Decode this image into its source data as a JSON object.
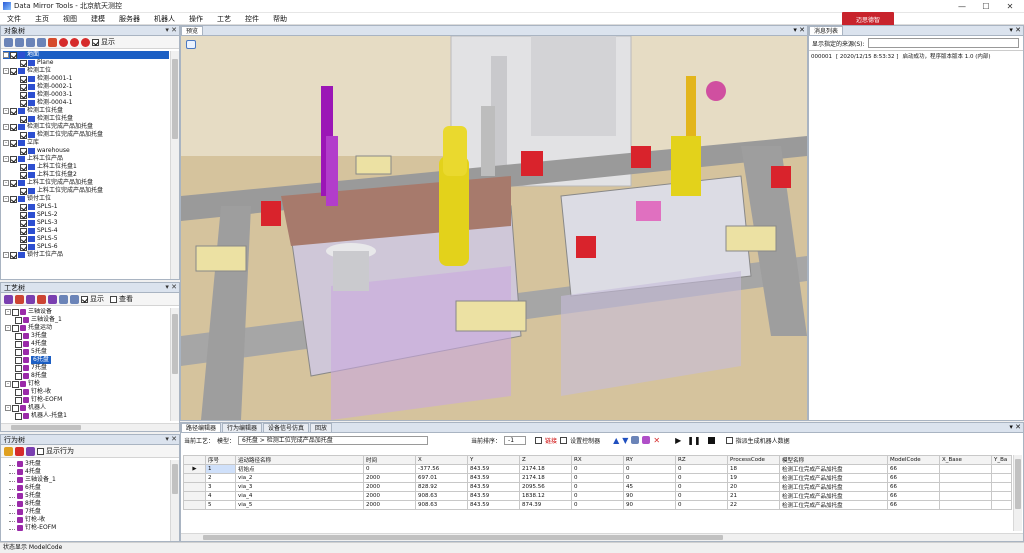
{
  "window": {
    "title": "Data Mirror Tools - 北京航天测控",
    "minimize": "—",
    "maximize": "☐",
    "close": "✕"
  },
  "menu": [
    "文件",
    "主页",
    "视图",
    "建模",
    "服务器",
    "机器人",
    "操作",
    "工艺",
    "控件",
    "帮助"
  ],
  "brand": {
    "logo_text": "迈思德智"
  },
  "object_tree": {
    "title": "对象树",
    "show_label": "显示",
    "items": [
      {
        "level": 0,
        "label": "地面",
        "expand": "-",
        "selected": true
      },
      {
        "level": 1,
        "label": "Plane"
      },
      {
        "level": 0,
        "label": "检测工位",
        "expand": "-"
      },
      {
        "level": 1,
        "label": "检测-0001-1"
      },
      {
        "level": 1,
        "label": "检测-0002-1"
      },
      {
        "level": 1,
        "label": "检测-0003-1"
      },
      {
        "level": 1,
        "label": "检测-0004-1"
      },
      {
        "level": 0,
        "label": "检测工位托盘",
        "expand": "-"
      },
      {
        "level": 1,
        "label": "检测工位托盘"
      },
      {
        "level": 0,
        "label": "检测工位完成产品加托盘",
        "expand": "-"
      },
      {
        "level": 1,
        "label": "检测工位完成产品加托盘"
      },
      {
        "level": 0,
        "label": "立库",
        "expand": "-"
      },
      {
        "level": 1,
        "label": "warehouse"
      },
      {
        "level": 0,
        "label": "上料工位产品",
        "expand": "-"
      },
      {
        "level": 1,
        "label": "上料工位托盘1"
      },
      {
        "level": 1,
        "label": "上料工位托盘2"
      },
      {
        "level": 0,
        "label": "上料工位完成产品加托盘",
        "expand": "-"
      },
      {
        "level": 1,
        "label": "上料工位完成产品加托盘"
      },
      {
        "level": 0,
        "label": "锁付工位",
        "expand": "-"
      },
      {
        "level": 1,
        "label": "SPLS-1"
      },
      {
        "level": 1,
        "label": "SPLS-2"
      },
      {
        "level": 1,
        "label": "SPLS-3"
      },
      {
        "level": 1,
        "label": "SPLS-4"
      },
      {
        "level": 1,
        "label": "SPLS-5"
      },
      {
        "level": 1,
        "label": "SPLS-6"
      },
      {
        "level": 0,
        "label": "锁付工位产品",
        "expand": "-"
      }
    ]
  },
  "process_tree": {
    "title": "工艺树",
    "show_label": "显示",
    "view_label": "查看",
    "items": [
      {
        "level": 0,
        "label": "三轴设备",
        "expand": "-"
      },
      {
        "level": 1,
        "label": "三轴设备_1"
      },
      {
        "level": 0,
        "label": "托盘运动",
        "expand": "-"
      },
      {
        "level": 1,
        "label": "3托盘"
      },
      {
        "level": 1,
        "label": "4托盘"
      },
      {
        "level": 1,
        "label": "5托盘"
      },
      {
        "level": 1,
        "label": "6托盘",
        "selected": true
      },
      {
        "level": 1,
        "label": "7托盘"
      },
      {
        "level": 1,
        "label": "8托盘"
      },
      {
        "level": 0,
        "label": "钉枪",
        "expand": "-"
      },
      {
        "level": 1,
        "label": "钉枪-收"
      },
      {
        "level": 1,
        "label": "钉枪-EOFM"
      },
      {
        "level": 0,
        "label": "机器人",
        "expand": "-"
      },
      {
        "level": 1,
        "label": "机器人-托盘1"
      }
    ]
  },
  "behavior_list": {
    "title": "行为树",
    "show_label": "显示行为",
    "items": [
      "3托盘",
      "4托盘",
      "三轴设备_1",
      "6托盘",
      "5托盘",
      "8托盘",
      "7托盘",
      "钉枪-收",
      "钉枪-EOFM"
    ]
  },
  "viewport": {
    "tab": "预览"
  },
  "message_list": {
    "tab": "消息列表",
    "source_label": "显示指定的来源(S):",
    "messages": [
      {
        "id": "000001",
        "time": "[ 2020/12/15 8:53:32 ]",
        "text": "启动成功，程序版本版本 1.0 (内部)"
      }
    ]
  },
  "bottom": {
    "tabs": [
      "路径编辑器",
      "行为编辑器",
      "设备信号仿真",
      "回放"
    ],
    "current_label": "当前工艺：",
    "model_label": "模型：",
    "model_value": "6托盘 > 检测工位完成产品加托盘",
    "order_label": "当前排序：",
    "order_value": "-1",
    "chk_link": "链接",
    "chk_set_ctrl": "设置控制器",
    "chk_assist": "指派生成机器人数据",
    "columns": [
      "序号",
      "运动路径名称",
      "时间",
      "X",
      "Y",
      "Z",
      "RX",
      "RY",
      "RZ",
      "ProcessCode",
      "模型名称",
      "ModelCode",
      "X_Base",
      "Y_Ba"
    ],
    "rows": [
      [
        "1",
        "初始点",
        "0",
        "-377.56",
        "843.59",
        "2174.18",
        "0",
        "0",
        "0",
        "18",
        "检测工位完成产品加托盘",
        "66",
        "",
        ""
      ],
      [
        "2",
        "via_2",
        "2000",
        "697.01",
        "843.59",
        "2174.18",
        "0",
        "0",
        "0",
        "19",
        "检测工位完成产品加托盘",
        "66",
        "",
        ""
      ],
      [
        "3",
        "via_3",
        "2000",
        "828.92",
        "843.59",
        "2095.56",
        "0",
        "45",
        "0",
        "20",
        "检测工位完成产品加托盘",
        "66",
        "",
        ""
      ],
      [
        "4",
        "via_4",
        "2000",
        "908.63",
        "843.59",
        "1838.12",
        "0",
        "90",
        "0",
        "21",
        "检测工位完成产品加托盘",
        "66",
        "",
        ""
      ],
      [
        "5",
        "via_5",
        "2000",
        "908.63",
        "843.59",
        "874.39",
        "0",
        "90",
        "0",
        "22",
        "检测工位完成产品加托盘",
        "66",
        "",
        ""
      ]
    ]
  },
  "status": {
    "text": "状态显示  ModelCode"
  },
  "colors": {
    "panel_header": "#dbe3ee",
    "selection": "#1c5fc4",
    "robot_yellow": "#e3d21b",
    "robot_purple": "#9b16b6"
  }
}
